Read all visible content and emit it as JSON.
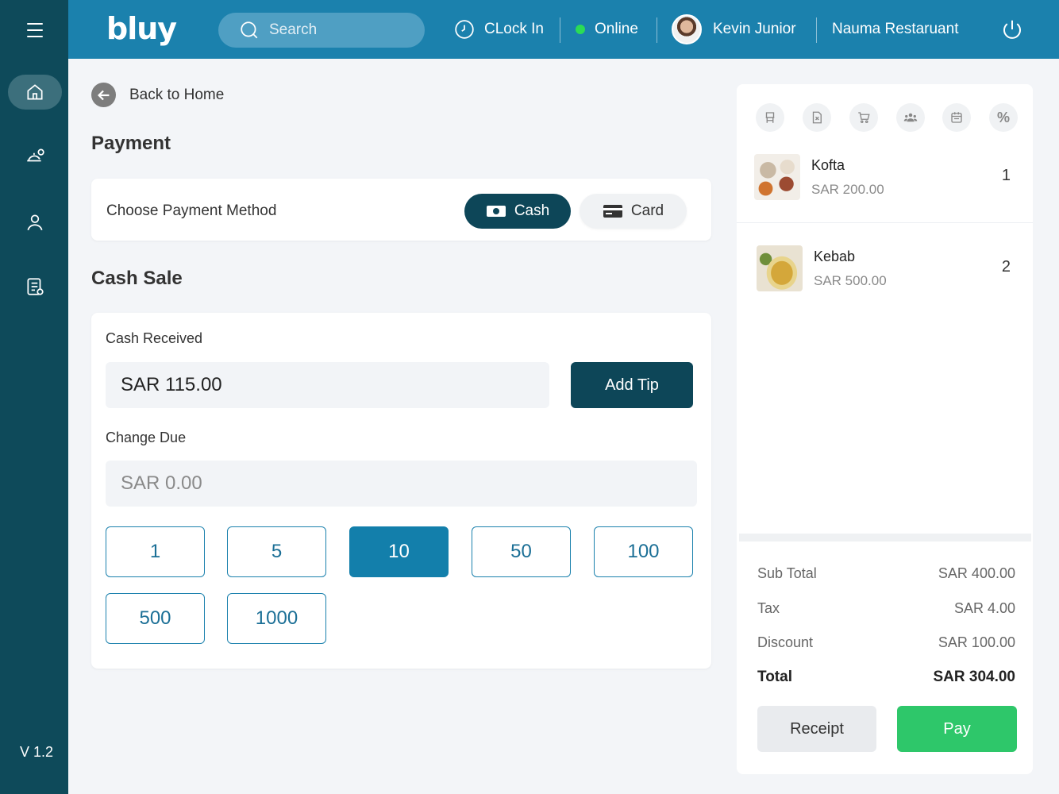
{
  "app": {
    "logo_text": "bluy",
    "version": "V 1.2"
  },
  "header": {
    "search_placeholder": "Search",
    "clock_in": "CLock In",
    "status": "Online",
    "user_name": "Kevin Junior",
    "restaurant": "Nauma Restaruant"
  },
  "main": {
    "back_label": "Back to Home",
    "payment_title": "Payment",
    "choose_method": "Choose Payment Method",
    "methods": {
      "cash": "Cash",
      "card": "Card"
    },
    "cash_sale_title": "Cash Sale",
    "cash_received_label": "Cash Received",
    "cash_received_value": "SAR 115.00",
    "add_tip": "Add Tip",
    "change_due_label": "Change Due",
    "change_due_value": "SAR 0.00",
    "amounts": [
      "1",
      "5",
      "10",
      "50",
      "100",
      "500",
      "1000"
    ],
    "selected_amount": "10"
  },
  "order": {
    "items": [
      {
        "name": "Kofta",
        "price": "SAR 200.00",
        "qty": "1"
      },
      {
        "name": "Kebab",
        "price": "SAR 500.00",
        "qty": "2"
      }
    ],
    "summary": {
      "subtotal_label": "Sub Total",
      "subtotal": "SAR 400.00",
      "tax_label": "Tax",
      "tax": "SAR 4.00",
      "discount_label": "Discount",
      "discount": "SAR 100.00",
      "total_label": "Total",
      "total": "SAR 304.00"
    },
    "receipt": "Receipt",
    "pay": "Pay"
  },
  "colors": {
    "sidebar": "#0e4a5a",
    "header": "#1b81ad",
    "primary_dark": "#0d4658",
    "selected_amount": "#137fab",
    "pay": "#2ec76a",
    "online_dot": "#2bdc55"
  }
}
